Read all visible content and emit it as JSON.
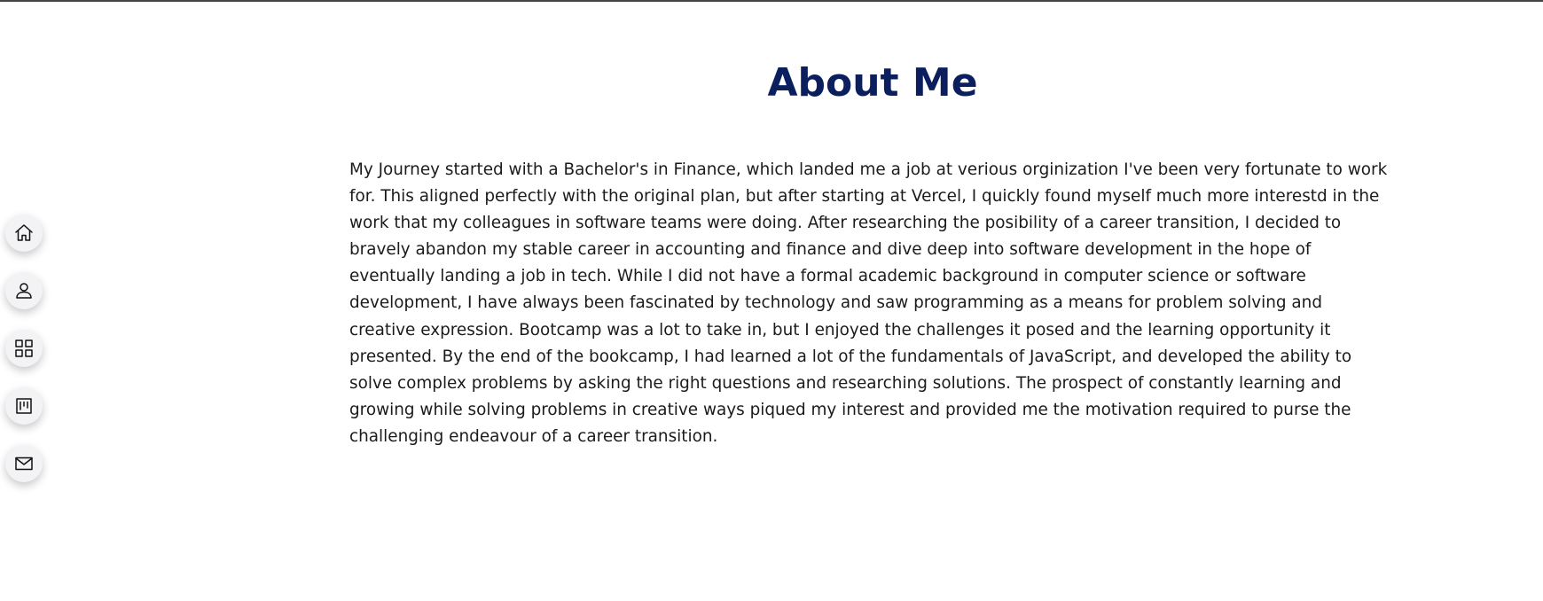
{
  "header": {
    "title": "About Me"
  },
  "about": {
    "paragraph": "My Journey started with a Bachelor's in Finance, which landed me a job at verious orginization I've been very fortunate to work for. This aligned perfectly with the original plan, but after starting at Vercel, I quickly found myself much more interestd in the work that my colleagues in software teams were doing. After researching the posibility of a career transition, I decided to bravely abandon my stable career in accounting and finance and dive deep into software development in the hope of eventually landing a job in tech. While I did not have a formal academic background in computer science or software development, I have always been fascinated by technology and saw programming as a means for problem solving and creative expression. Bootcamp was a lot to take in, but I enjoyed the challenges it posed and the learning opportunity it presented. By the end of the bookcamp, I had learned a lot of the fundamentals of JavaScript, and developed the ability to solve complex problems by asking the right questions and researching solutions. The prospect of constantly learning and growing while solving problems in creative ways piqued my interest and provided me the motivation required to purse the challenging endeavour of a career transition."
  },
  "sidebar": {
    "items": [
      {
        "icon": "home-icon"
      },
      {
        "icon": "user-icon"
      },
      {
        "icon": "grid-icon"
      },
      {
        "icon": "kanban-icon"
      },
      {
        "icon": "mail-icon"
      }
    ]
  },
  "colors": {
    "title": "#0b1f5e",
    "text": "#1b1b1b",
    "nav_button_bg": "#f3f3f5",
    "top_border": "#444444"
  }
}
